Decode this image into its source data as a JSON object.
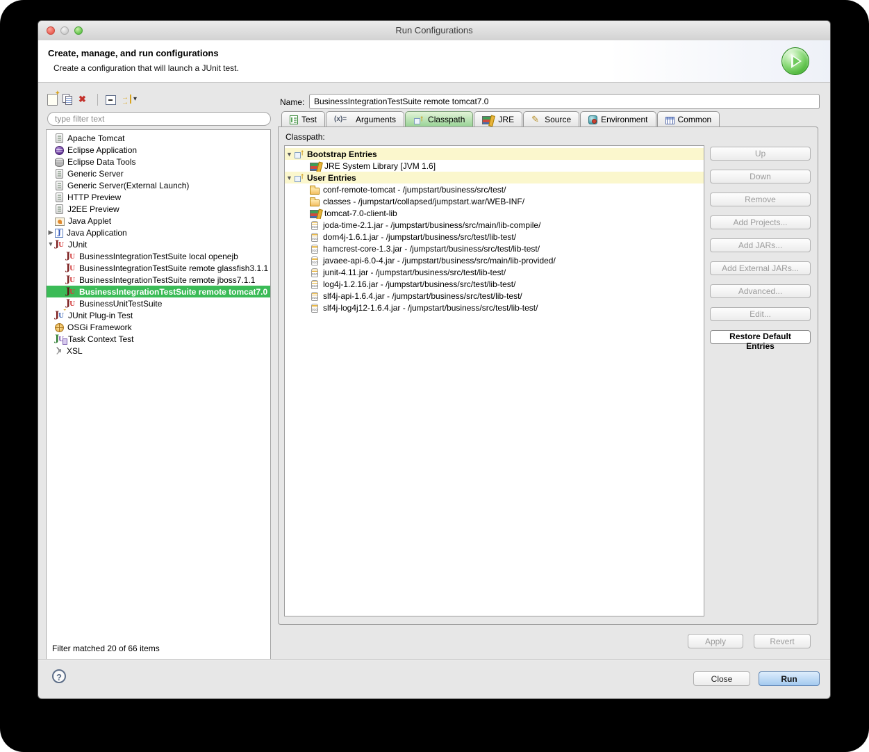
{
  "window": {
    "title": "Run Configurations",
    "header": {
      "title": "Create, manage, and run configurations",
      "subtitle": "Create a configuration that will launch a JUnit test."
    }
  },
  "sidebar": {
    "toolbar": [
      {
        "name": "new-configuration-button",
        "icon": "new-config-icon"
      },
      {
        "name": "duplicate-configuration-button",
        "icon": "duplicate-icon"
      },
      {
        "name": "delete-configuration-button",
        "icon": "delete-icon"
      },
      {
        "separator": true
      },
      {
        "name": "collapse-all-button",
        "icon": "collapse-all-icon"
      },
      {
        "name": "filter-button",
        "icon": "filter-icon",
        "dropdown": true
      }
    ],
    "filter_placeholder": "type filter text",
    "tree": [
      {
        "icon": "server-icon",
        "label": "Apache Tomcat",
        "depth": 1
      },
      {
        "icon": "eclipse-icon",
        "label": "Eclipse Application",
        "depth": 1
      },
      {
        "icon": "db-icon",
        "label": "Eclipse Data Tools",
        "depth": 1
      },
      {
        "icon": "server-icon",
        "label": "Generic Server",
        "depth": 1
      },
      {
        "icon": "server-icon",
        "label": "Generic Server(External Launch)",
        "depth": 1
      },
      {
        "icon": "server-icon",
        "label": "HTTP Preview",
        "depth": 1
      },
      {
        "icon": "server-icon",
        "label": "J2EE Preview",
        "depth": 1
      },
      {
        "icon": "applet-icon",
        "label": "Java Applet",
        "depth": 1
      },
      {
        "icon": "java-icon",
        "label": "Java Application",
        "depth": 1,
        "arrow": "collapsed"
      },
      {
        "icon": "junit-icon",
        "label": "JUnit",
        "depth": 1,
        "arrow": "expanded"
      },
      {
        "icon": "junit-icon",
        "label": "BusinessIntegrationTestSuite local openejb",
        "depth": 2
      },
      {
        "icon": "junit-icon",
        "label": "BusinessIntegrationTestSuite remote glassfish3.1.1",
        "depth": 2
      },
      {
        "icon": "junit-icon",
        "label": "BusinessIntegrationTestSuite remote jboss7.1.1",
        "depth": 2
      },
      {
        "icon": "junit-icon",
        "label": "BusinessIntegrationTestSuite remote tomcat7.0",
        "depth": 2,
        "selected": true
      },
      {
        "icon": "junit-icon",
        "label": "BusinessUnitTestSuite",
        "depth": 2
      },
      {
        "icon": "junit-plugin-icon",
        "label": "JUnit Plug-in Test",
        "depth": 1
      },
      {
        "icon": "osgi-icon",
        "label": "OSGi Framework",
        "depth": 1
      },
      {
        "icon": "task-icon",
        "label": "Task Context Test",
        "depth": 1
      },
      {
        "icon": "xsl-icon",
        "label": "XSL",
        "depth": 1
      }
    ],
    "status": "Filter matched 20 of 66 items"
  },
  "main": {
    "name_label": "Name:",
    "name_value": "BusinessIntegrationTestSuite remote tomcat7.0",
    "tabs": [
      {
        "id": "test",
        "label": "Test",
        "icon": "test-icon"
      },
      {
        "id": "arguments",
        "label": "Arguments",
        "icon": "args-icon"
      },
      {
        "id": "classpath",
        "label": "Classpath",
        "icon": "classpath-icon",
        "selected": true
      },
      {
        "id": "jre",
        "label": "JRE",
        "icon": "library-icon"
      },
      {
        "id": "source",
        "label": "Source",
        "icon": "source-icon"
      },
      {
        "id": "environment",
        "label": "Environment",
        "icon": "environment-icon"
      },
      {
        "id": "common",
        "label": "Common",
        "icon": "common-icon"
      }
    ],
    "classpath_label": "Classpath:",
    "classpath_tree": [
      {
        "icon": "classpath-icon",
        "label": "Bootstrap Entries",
        "header": true,
        "arrow": "expanded"
      },
      {
        "icon": "library-icon",
        "label": "JRE System Library [JVM 1.6]",
        "depth": 1
      },
      {
        "icon": "classpath-icon",
        "label": "User Entries",
        "header": true,
        "arrow": "expanded"
      },
      {
        "icon": "folder-icon",
        "label": "conf-remote-tomcat - /jumpstart/business/src/test/",
        "depth": 1
      },
      {
        "icon": "folder-icon",
        "label": "classes - /jumpstart/collapsed/jumpstart.war/WEB-INF/",
        "depth": 1
      },
      {
        "icon": "library-icon",
        "label": "tomcat-7.0-client-lib",
        "depth": 1
      },
      {
        "icon": "jar-icon",
        "label": "joda-time-2.1.jar - /jumpstart/business/src/main/lib-compile/",
        "depth": 1
      },
      {
        "icon": "jar-icon",
        "label": "dom4j-1.6.1.jar - /jumpstart/business/src/test/lib-test/",
        "depth": 1
      },
      {
        "icon": "jar-icon",
        "label": "hamcrest-core-1.3.jar - /jumpstart/business/src/test/lib-test/",
        "depth": 1
      },
      {
        "icon": "jar-icon",
        "label": "javaee-api-6.0-4.jar - /jumpstart/business/src/main/lib-provided/",
        "depth": 1
      },
      {
        "icon": "jar-icon",
        "label": "junit-4.11.jar - /jumpstart/business/src/test/lib-test/",
        "depth": 1
      },
      {
        "icon": "jar-icon",
        "label": "log4j-1.2.16.jar - /jumpstart/business/src/test/lib-test/",
        "depth": 1
      },
      {
        "icon": "jar-icon",
        "label": "slf4j-api-1.6.4.jar - /jumpstart/business/src/test/lib-test/",
        "depth": 1
      },
      {
        "icon": "jar-icon",
        "label": "slf4j-log4j12-1.6.4.jar - /jumpstart/business/src/test/lib-test/",
        "depth": 1
      }
    ],
    "side_buttons": [
      {
        "label": "Up",
        "enabled": false
      },
      {
        "label": "Down",
        "enabled": false
      },
      {
        "label": "Remove",
        "enabled": false
      },
      {
        "label": "Add Projects...",
        "enabled": false
      },
      {
        "label": "Add JARs...",
        "enabled": false
      },
      {
        "label": "Add External JARs...",
        "enabled": false
      },
      {
        "label": "Advanced...",
        "enabled": false
      },
      {
        "label": "Edit...",
        "enabled": false
      },
      {
        "label": "Restore Default Entries",
        "enabled": true,
        "emphasized": true
      }
    ],
    "apply_label": "Apply",
    "revert_label": "Revert"
  },
  "footer": {
    "help_glyph": "?",
    "close_label": "Close",
    "run_label": "Run"
  },
  "colors": {
    "selection_green": "#3bbb57",
    "entry_row_yellow": "#fbf7cd",
    "tab_selected_green": "#95d193",
    "run_button_blue": "#a3c9ef"
  }
}
